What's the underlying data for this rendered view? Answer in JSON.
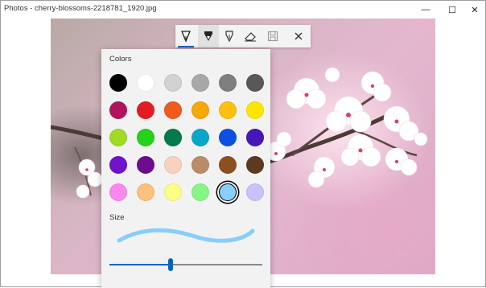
{
  "window": {
    "title": "Photos - cherry-blossoms-2218781_1920.jpg",
    "minimize_glyph": "—",
    "maximize_glyph": "☐",
    "close_glyph": "✕"
  },
  "toolbar": {
    "tools": [
      {
        "name": "ballpoint-pen",
        "icon": "ballpoint-pen-icon",
        "active": true
      },
      {
        "name": "pencil",
        "icon": "pencil-icon",
        "active": false
      },
      {
        "name": "calligraphy-pen",
        "icon": "calligraphy-pen-icon",
        "active": false
      },
      {
        "name": "eraser",
        "icon": "eraser-icon",
        "active": false
      },
      {
        "name": "save",
        "icon": "save-icon",
        "active": false
      },
      {
        "name": "close",
        "icon": "close-icon",
        "active": false
      }
    ]
  },
  "flyout": {
    "colors_label": "Colors",
    "size_label": "Size",
    "selected_color": "#87cefa",
    "size_value": 0.4,
    "colors": [
      [
        "#000000",
        "#ffffff",
        "#d2d2d2",
        "#a8a8a8",
        "#7f7f7f",
        "#585858"
      ],
      [
        "#b3135d",
        "#e31c23",
        "#f15a1d",
        "#f7a70a",
        "#fec00f",
        "#ffe600"
      ],
      [
        "#a1da23",
        "#24d21b",
        "#027a4a",
        "#0aa6c8",
        "#0b50e0",
        "#4616b9"
      ],
      [
        "#7113c9",
        "#6d0c8e",
        "#f7d2bd",
        "#b98d68",
        "#8b4f22",
        "#5e3920"
      ],
      [
        "#fc87ef",
        "#fdc07d",
        "#fefd85",
        "#86f787",
        "#87cefa",
        "#c8c3fc"
      ]
    ]
  }
}
